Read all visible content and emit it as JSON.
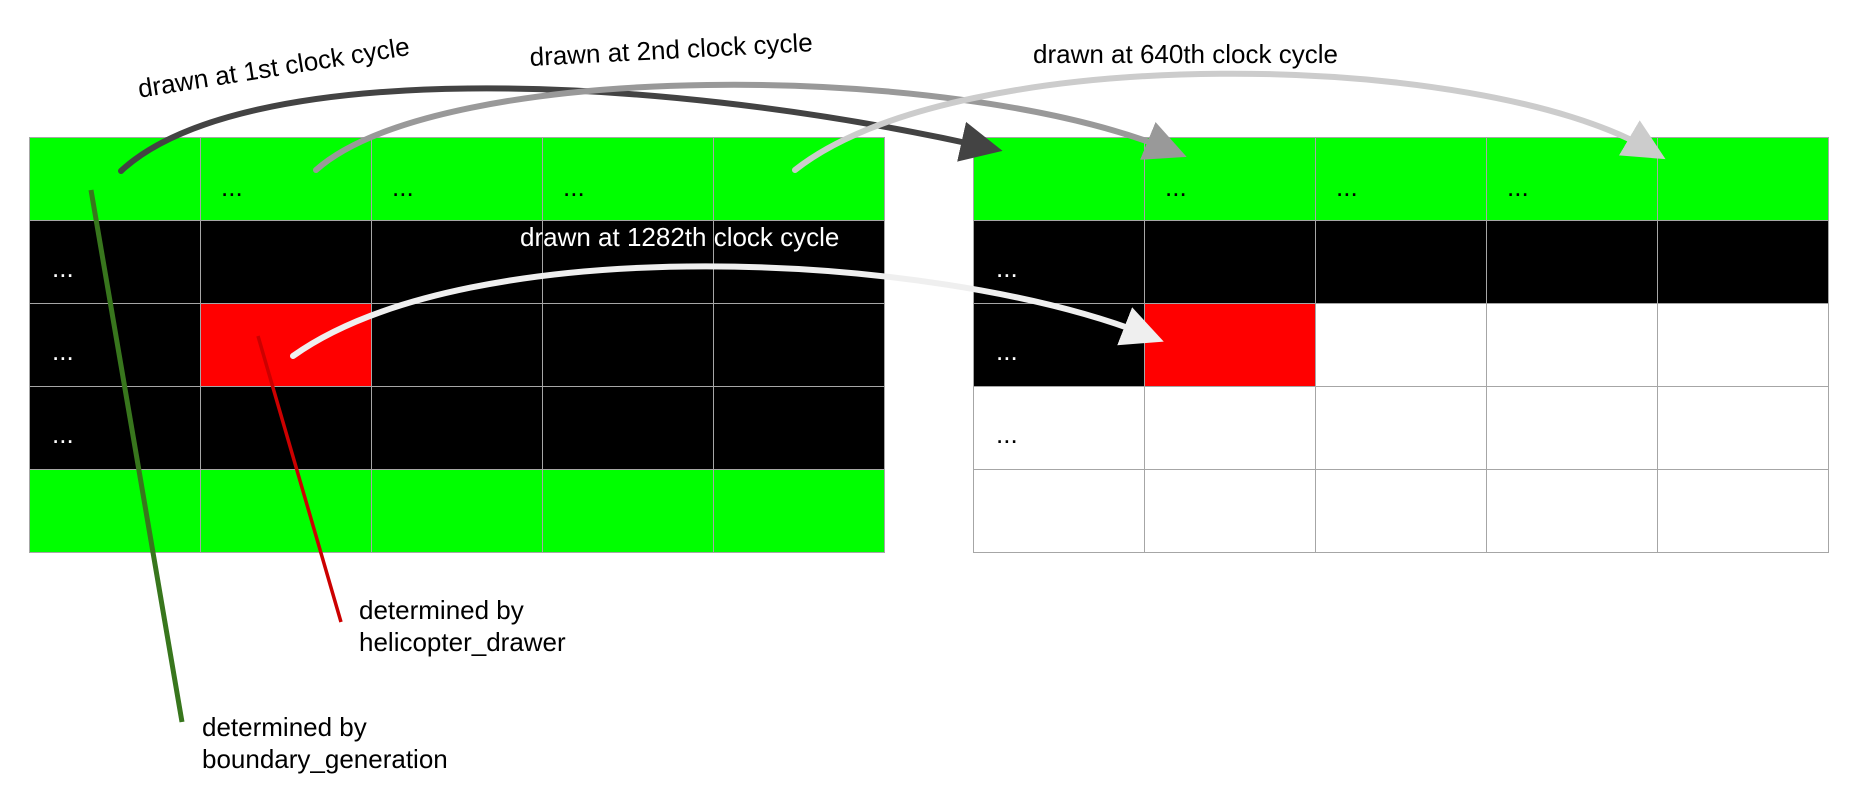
{
  "colors": {
    "green": "#00ff00",
    "black": "#000000",
    "red": "#ff0000",
    "white": "#ffffff",
    "grid_line": "#a6a6a6",
    "boundary_line": "#38761d",
    "helicopter_line": "#cc0000",
    "arrow_cycle1": "#434343",
    "arrow_cycle2": "#999999",
    "arrow_cycle640": "#cccccc",
    "arrow_cycle1282": "#efefef"
  },
  "ellipsis": "...",
  "left_grid": {
    "rows": [
      [
        {
          "fill": "green",
          "text": ""
        },
        {
          "fill": "green",
          "text": "..."
        },
        {
          "fill": "green",
          "text": "..."
        },
        {
          "fill": "green",
          "text": "..."
        },
        {
          "fill": "green",
          "text": ""
        }
      ],
      [
        {
          "fill": "black",
          "text": "..."
        },
        {
          "fill": "black",
          "text": ""
        },
        {
          "fill": "black",
          "text": ""
        },
        {
          "fill": "black",
          "text": ""
        },
        {
          "fill": "black",
          "text": ""
        }
      ],
      [
        {
          "fill": "black",
          "text": "..."
        },
        {
          "fill": "red",
          "text": ""
        },
        {
          "fill": "black",
          "text": ""
        },
        {
          "fill": "black",
          "text": ""
        },
        {
          "fill": "black",
          "text": ""
        }
      ],
      [
        {
          "fill": "black",
          "text": "..."
        },
        {
          "fill": "black",
          "text": ""
        },
        {
          "fill": "black",
          "text": ""
        },
        {
          "fill": "black",
          "text": ""
        },
        {
          "fill": "black",
          "text": ""
        }
      ],
      [
        {
          "fill": "green",
          "text": ""
        },
        {
          "fill": "green",
          "text": ""
        },
        {
          "fill": "green",
          "text": ""
        },
        {
          "fill": "green",
          "text": ""
        },
        {
          "fill": "green",
          "text": ""
        }
      ]
    ]
  },
  "right_grid": {
    "rows": [
      [
        {
          "fill": "green",
          "text": ""
        },
        {
          "fill": "green",
          "text": "..."
        },
        {
          "fill": "green",
          "text": "..."
        },
        {
          "fill": "green",
          "text": "..."
        },
        {
          "fill": "green",
          "text": ""
        }
      ],
      [
        {
          "fill": "black",
          "text": "..."
        },
        {
          "fill": "black",
          "text": ""
        },
        {
          "fill": "black",
          "text": ""
        },
        {
          "fill": "black",
          "text": ""
        },
        {
          "fill": "black",
          "text": ""
        }
      ],
      [
        {
          "fill": "black",
          "text": "..."
        },
        {
          "fill": "red",
          "text": ""
        },
        {
          "fill": "white",
          "text": ""
        },
        {
          "fill": "white",
          "text": ""
        },
        {
          "fill": "white",
          "text": ""
        }
      ],
      [
        {
          "fill": "white",
          "text": "..."
        },
        {
          "fill": "white",
          "text": ""
        },
        {
          "fill": "white",
          "text": ""
        },
        {
          "fill": "white",
          "text": ""
        },
        {
          "fill": "white",
          "text": ""
        }
      ],
      [
        {
          "fill": "white",
          "text": ""
        },
        {
          "fill": "white",
          "text": ""
        },
        {
          "fill": "white",
          "text": ""
        },
        {
          "fill": "white",
          "text": ""
        },
        {
          "fill": "white",
          "text": ""
        }
      ]
    ]
  },
  "arrows": [
    {
      "label": "drawn at 1st clock cycle",
      "color": "arrow_cycle1"
    },
    {
      "label": "drawn at 2nd clock cycle",
      "color": "arrow_cycle2"
    },
    {
      "label": "drawn at 640th clock cycle",
      "color": "arrow_cycle640"
    },
    {
      "label": "drawn at 1282th clock cycle",
      "color": "arrow_cycle1282"
    }
  ],
  "notes": {
    "helicopter": {
      "line1": "determined by",
      "line2": "helicopter_drawer"
    },
    "boundary": {
      "line1": "determined by",
      "line2": "boundary_generation"
    }
  }
}
